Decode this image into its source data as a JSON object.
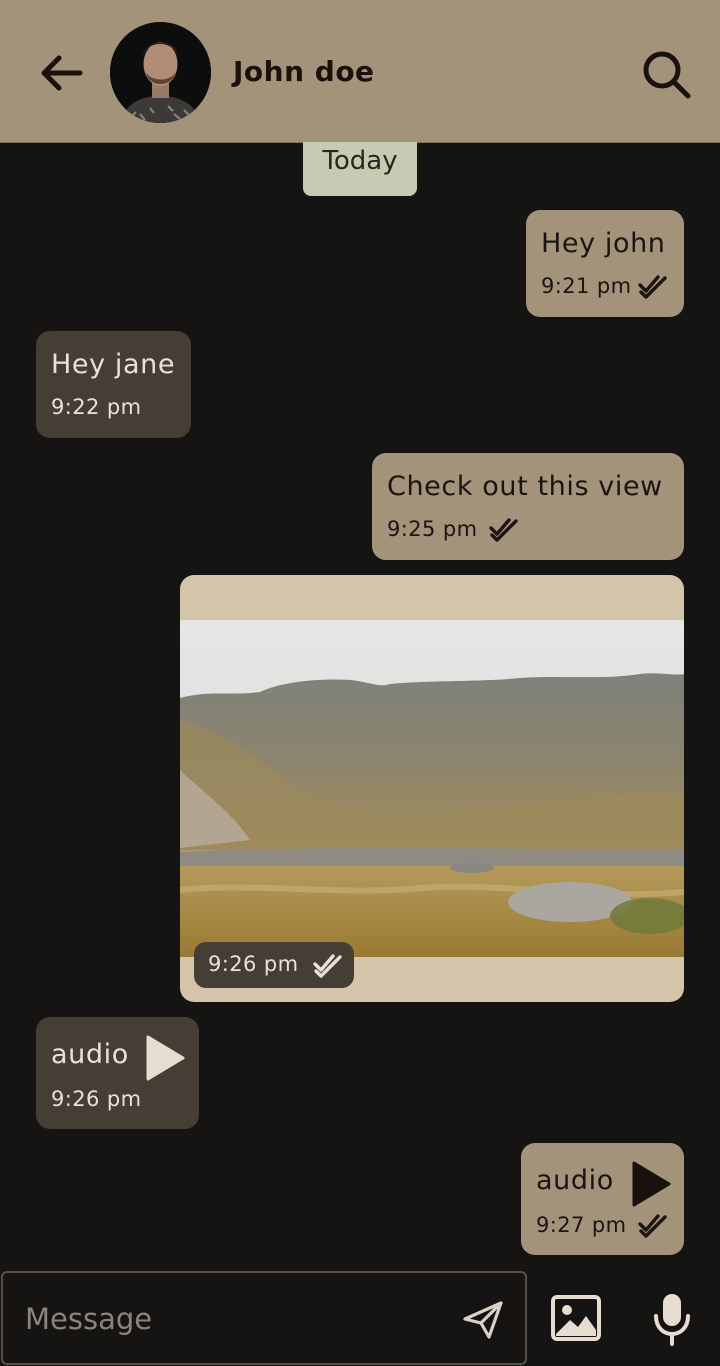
{
  "header": {
    "contact_name": "John doe",
    "back_icon": "arrow-left-icon",
    "search_icon": "search-icon"
  },
  "date_separator": "Today",
  "messages": [
    {
      "direction": "outgoing",
      "type": "text",
      "text": "Hey john",
      "time": "9:21 pm",
      "status": "delivered"
    },
    {
      "direction": "incoming",
      "type": "text",
      "text": "Hey jane",
      "time": "9:22 pm"
    },
    {
      "direction": "outgoing",
      "type": "text",
      "text": "Check out this view",
      "time": "9:25 pm",
      "status": "delivered"
    },
    {
      "direction": "outgoing",
      "type": "image",
      "time": "9:26 pm",
      "status": "delivered"
    },
    {
      "direction": "incoming",
      "type": "audio",
      "text": "audio",
      "time": "9:26 pm"
    },
    {
      "direction": "outgoing",
      "type": "audio",
      "text": "audio",
      "time": "9:27 pm",
      "status": "delivered"
    }
  ],
  "composer": {
    "placeholder": "Message",
    "value": "",
    "send_icon": "send-icon",
    "image_icon": "image-icon",
    "mic_icon": "microphone-icon"
  },
  "colors": {
    "header_bg": "#a3937b",
    "outgoing_bubble": "#a3937b",
    "incoming_bubble": "#453e35",
    "date_chip": "#c6ccb4",
    "photo_frame": "#d4c5aa",
    "background": "#151413"
  }
}
